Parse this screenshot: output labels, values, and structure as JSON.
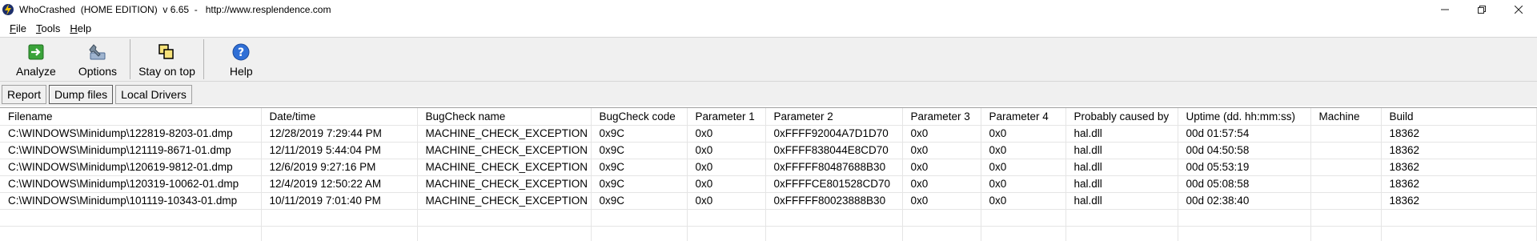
{
  "window": {
    "title": "WhoCrashed  (HOME EDITION)  v 6.65  -   http://www.resplendence.com",
    "controls": [
      "minimize",
      "restore",
      "close"
    ]
  },
  "menu": [
    {
      "label": "File",
      "accel": "F",
      "rest": "ile"
    },
    {
      "label": "Tools",
      "accel": "T",
      "rest": "ools"
    },
    {
      "label": "Help",
      "accel": "H",
      "rest": "elp"
    }
  ],
  "toolbar": {
    "analyze": "Analyze",
    "options": "Options",
    "stay_on_top": "Stay on top",
    "help": "Help"
  },
  "tabs": [
    {
      "label": "Report",
      "active": false
    },
    {
      "label": "Dump files",
      "active": true
    },
    {
      "label": "Local Drivers",
      "active": false
    }
  ],
  "columns": [
    "Filename",
    "Date/time",
    "BugCheck name",
    "BugCheck code",
    "Parameter 1",
    "Parameter 2",
    "Parameter 3",
    "Parameter 4",
    "Probably caused by",
    "Uptime (dd. hh:mm:ss)",
    "Machine",
    "Build"
  ],
  "rows": [
    [
      "C:\\WINDOWS\\Minidump\\122819-8203-01.dmp",
      "12/28/2019 7:29:44 PM",
      "MACHINE_CHECK_EXCEPTION",
      "0x9C",
      "0x0",
      "0xFFFF92004A7D1D70",
      "0x0",
      "0x0",
      "hal.dll",
      "00d 01:57:54",
      "",
      "18362"
    ],
    [
      "C:\\WINDOWS\\Minidump\\121119-8671-01.dmp",
      "12/11/2019 5:44:04 PM",
      "MACHINE_CHECK_EXCEPTION",
      "0x9C",
      "0x0",
      "0xFFFF838044E8CD70",
      "0x0",
      "0x0",
      "hal.dll",
      "00d 04:50:58",
      "",
      "18362"
    ],
    [
      "C:\\WINDOWS\\Minidump\\120619-9812-01.dmp",
      "12/6/2019 9:27:16 PM",
      "MACHINE_CHECK_EXCEPTION",
      "0x9C",
      "0x0",
      "0xFFFFF80487688B30",
      "0x0",
      "0x0",
      "hal.dll",
      "00d 05:53:19",
      "",
      "18362"
    ],
    [
      "C:\\WINDOWS\\Minidump\\120319-10062-01.dmp",
      "12/4/2019 12:50:22 AM",
      "MACHINE_CHECK_EXCEPTION",
      "0x9C",
      "0x0",
      "0xFFFFCE801528CD70",
      "0x0",
      "0x0",
      "hal.dll",
      "00d 05:08:58",
      "",
      "18362"
    ],
    [
      "C:\\WINDOWS\\Minidump\\101119-10343-01.dmp",
      "10/11/2019 7:01:40 PM",
      "MACHINE_CHECK_EXCEPTION",
      "0x9C",
      "0x0",
      "0xFFFFF80023888B30",
      "0x0",
      "0x0",
      "hal.dll",
      "00d 02:38:40",
      "",
      "18362"
    ]
  ],
  "empty_rows": 2
}
